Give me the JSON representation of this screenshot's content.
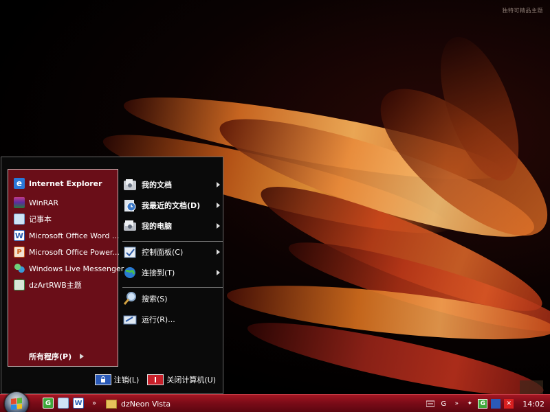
{
  "desktop": {
    "watermark": "独特可精品主题"
  },
  "start_menu": {
    "pinned": [
      {
        "label": "Internet Explorer",
        "icon": "internet-explorer-icon",
        "color": "#2a78d8"
      }
    ],
    "recent": [
      {
        "label": "WinRAR",
        "icon": "winrar-icon",
        "color": "#7a2c9c"
      },
      {
        "label": "记事本",
        "icon": "notepad-icon",
        "color": "#6fa6d8"
      },
      {
        "label": "Microsoft Office Word ...",
        "icon": "word-icon",
        "color": "#2b5fb4"
      },
      {
        "label": "Microsoft Office Power...",
        "icon": "powerpoint-icon",
        "color": "#d2601a"
      },
      {
        "label": "Windows Live Messenger",
        "icon": "messenger-icon",
        "color": "#3da84a"
      },
      {
        "label": "dzArtRWB主题",
        "icon": "theme-icon",
        "color": "#3a8a4a"
      }
    ],
    "all_programs": "所有程序(P)",
    "places": [
      {
        "label": "我的文档",
        "icon": "my-documents-icon",
        "bold": true,
        "submenu": true
      },
      {
        "label": "我最近的文档(D)",
        "icon": "recent-documents-icon",
        "bold": true,
        "submenu": true
      },
      {
        "label": "我的电脑",
        "icon": "my-computer-icon",
        "bold": true,
        "submenu": true
      },
      {
        "label": "控制面板(C)",
        "icon": "control-panel-icon",
        "bold": false,
        "submenu": true
      },
      {
        "label": "连接到(T)",
        "icon": "connect-to-icon",
        "bold": false,
        "submenu": true
      },
      {
        "label": "搜索(S)",
        "icon": "search-icon",
        "bold": false,
        "submenu": false
      },
      {
        "label": "运行(R)...",
        "icon": "run-icon",
        "bold": false,
        "submenu": false
      }
    ],
    "logoff_label": "注销(L)",
    "shutdown_label": "关闭计算机(U)"
  },
  "taskbar": {
    "quick_launch": [
      "green-g-icon",
      "notepad-icon",
      "word-icon"
    ],
    "overflow": "»",
    "task_label": "dzNeon Vista",
    "tray_letter": "G",
    "tray_overflow": "»",
    "clock": "14:02"
  },
  "colors": {
    "taskbar": "#8a1020",
    "left_pane": "#6a0e18",
    "menu_bg": "#0a0a0a"
  }
}
